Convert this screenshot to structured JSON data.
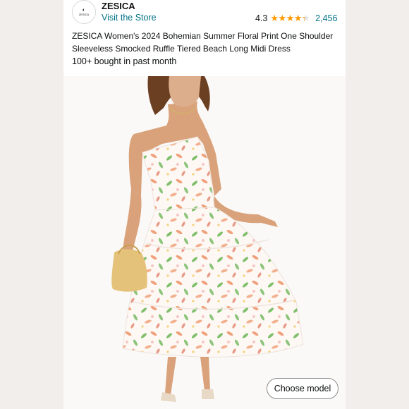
{
  "store": {
    "logo_text": "ZESICA",
    "brand": "ZESICA",
    "visit_link": "Visit the Store"
  },
  "rating": {
    "value": "4.3",
    "stars": 4.3,
    "count": "2,456"
  },
  "product": {
    "title": "ZESICA Women's 2024 Bohemian Summer Floral Print One Shoulder Sleeveless Smocked Ruffle Tiered Beach Long Midi Dress",
    "bought": "100+ bought in past month"
  },
  "actions": {
    "choose_model": "Choose model"
  },
  "colors": {
    "link": "#007185",
    "star": "#ff9900",
    "page_bg": "#f2eeec"
  }
}
